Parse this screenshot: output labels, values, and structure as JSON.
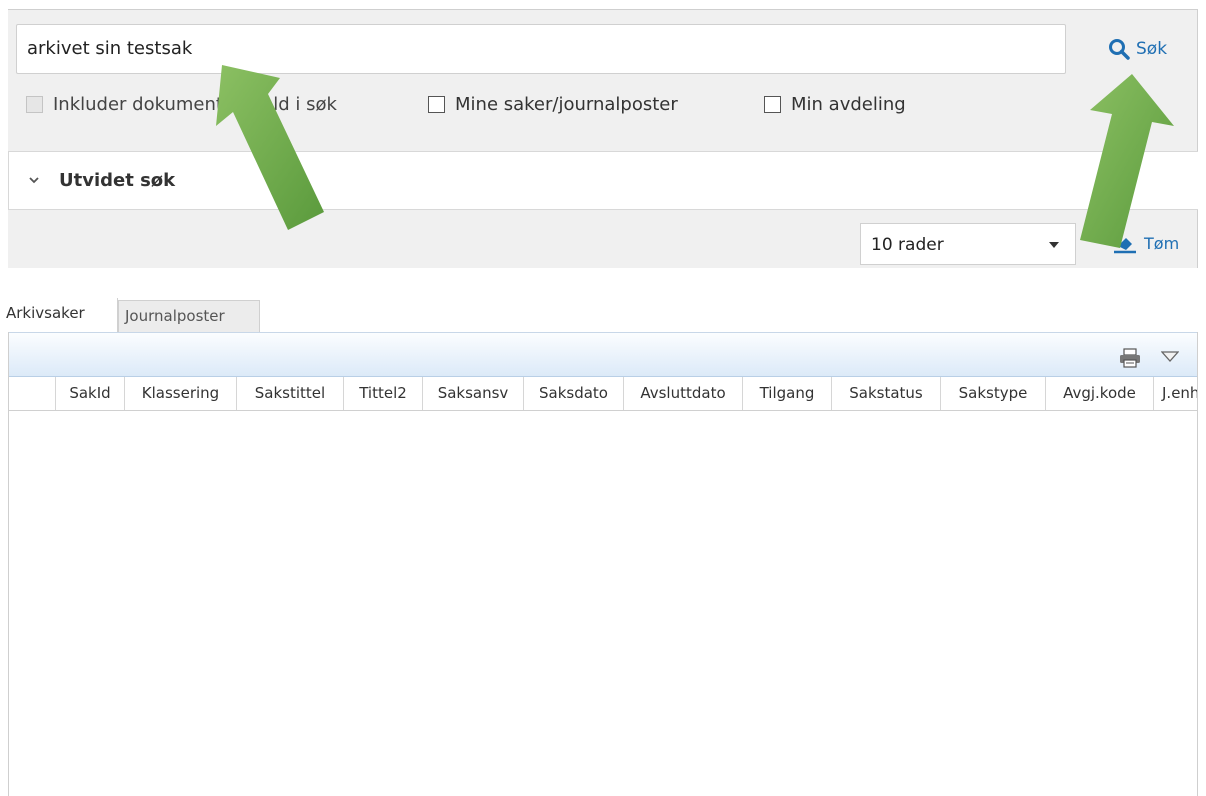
{
  "search": {
    "query": "arkivet sin testsak",
    "button_label": "Søk"
  },
  "options": {
    "include_content": "Inkluder dokumentinnhold i søk",
    "my_cases": "Mine saker/journalposter",
    "my_department": "Min avdeling"
  },
  "advanced": {
    "label": "Utvidet søk"
  },
  "rows": {
    "selected": "10 rader"
  },
  "clear": {
    "label": "Tøm"
  },
  "tabs": [
    {
      "label": "Arkivsaker"
    },
    {
      "label": "Journalposter"
    }
  ],
  "columns": [
    {
      "label": "SakId"
    },
    {
      "label": "Klassering"
    },
    {
      "label": "Sakstittel"
    },
    {
      "label": "Tittel2"
    },
    {
      "label": "Saksansv"
    },
    {
      "label": "Saksdato"
    },
    {
      "label": "Avsluttdato"
    },
    {
      "label": "Tilgang"
    },
    {
      "label": "Sakstatus"
    },
    {
      "label": "Sakstype"
    },
    {
      "label": "Avgj.kode"
    },
    {
      "label": "J.enhet"
    }
  ],
  "colors": {
    "accent": "#1f6fb3",
    "arrow_green": "#6aa84f"
  },
  "icons": [
    "search-icon",
    "chevron-down-icon",
    "eraser-icon",
    "print-icon",
    "dropdown-menu-icon",
    "annotation-arrow"
  ]
}
